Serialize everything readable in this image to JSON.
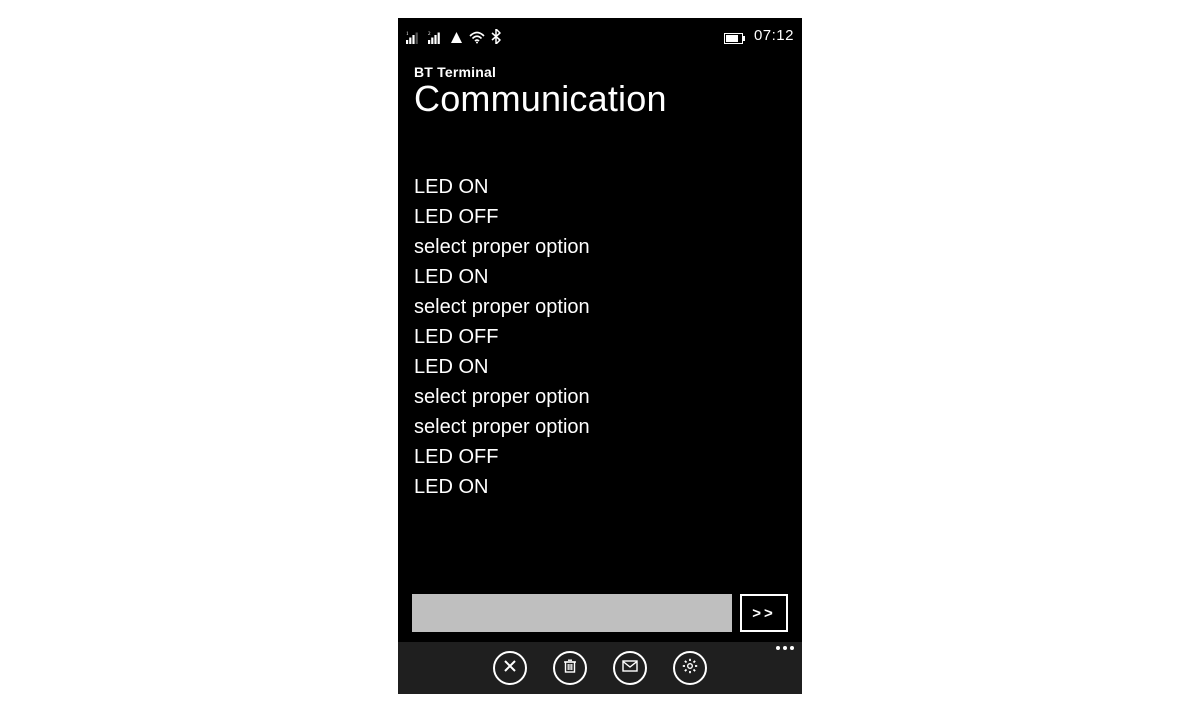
{
  "status_bar": {
    "clock": "07:12"
  },
  "header": {
    "app_name": "BT Terminal",
    "page_title": "Communication"
  },
  "log": [
    "LED ON",
    "LED OFF",
    "select proper option",
    "LED ON",
    "select proper option",
    "LED OFF",
    "LED ON",
    "select proper option",
    "select proper option",
    "LED OFF",
    "LED ON"
  ],
  "input": {
    "value": "",
    "placeholder": ""
  },
  "send_button": {
    "label": ">>"
  }
}
